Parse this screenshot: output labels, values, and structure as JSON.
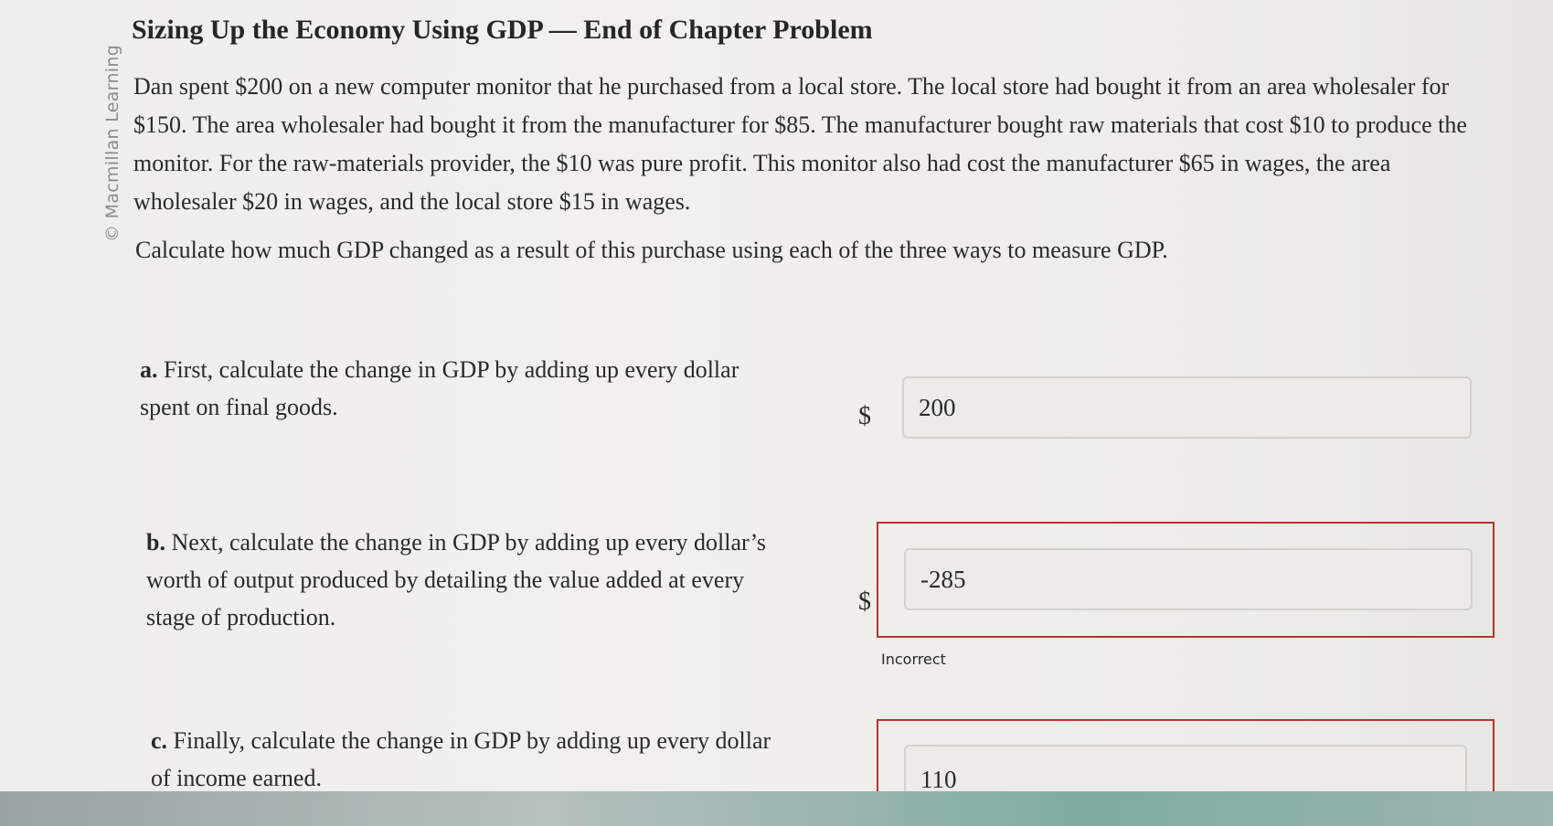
{
  "credit": "© Macmillan Learning",
  "title": "Sizing Up the Economy Using GDP — End of Chapter Problem",
  "problem_text": "Dan spent $200 on a new computer monitor that he purchased from a local store. The local store had bought it from an area wholesaler for $150. The area wholesaler had bought it from the manufacturer for $85. The manufacturer bought raw materials that cost $10 to produce the monitor. For the raw-materials provider, the $10 was pure profit. This monitor also had cost the manufacturer $65 in wages, the area wholesaler $20 in wages, and the local store $15 in wages.",
  "instruction": "Calculate how much GDP changed as a result of this purchase using each of the three ways to measure GDP.",
  "questions": [
    {
      "letter": "a.",
      "text": "First, calculate the change in GDP by adding up every dollar spent on final goods.",
      "currency": "$",
      "answer": "200",
      "feedback": ""
    },
    {
      "letter": "b.",
      "text": "Next, calculate the change in GDP by adding up every dollar’s worth of output produced by detailing the value added at every stage of production.",
      "currency": "$",
      "answer": "-285",
      "feedback": "Incorrect"
    },
    {
      "letter": "c.",
      "text": "Finally, calculate the change in GDP by adding up every dollar of income earned.",
      "currency": "",
      "answer": "110",
      "feedback": ""
    }
  ],
  "colors": {
    "incorrect_border": "#b63531",
    "input_background": "#ecebe7"
  }
}
